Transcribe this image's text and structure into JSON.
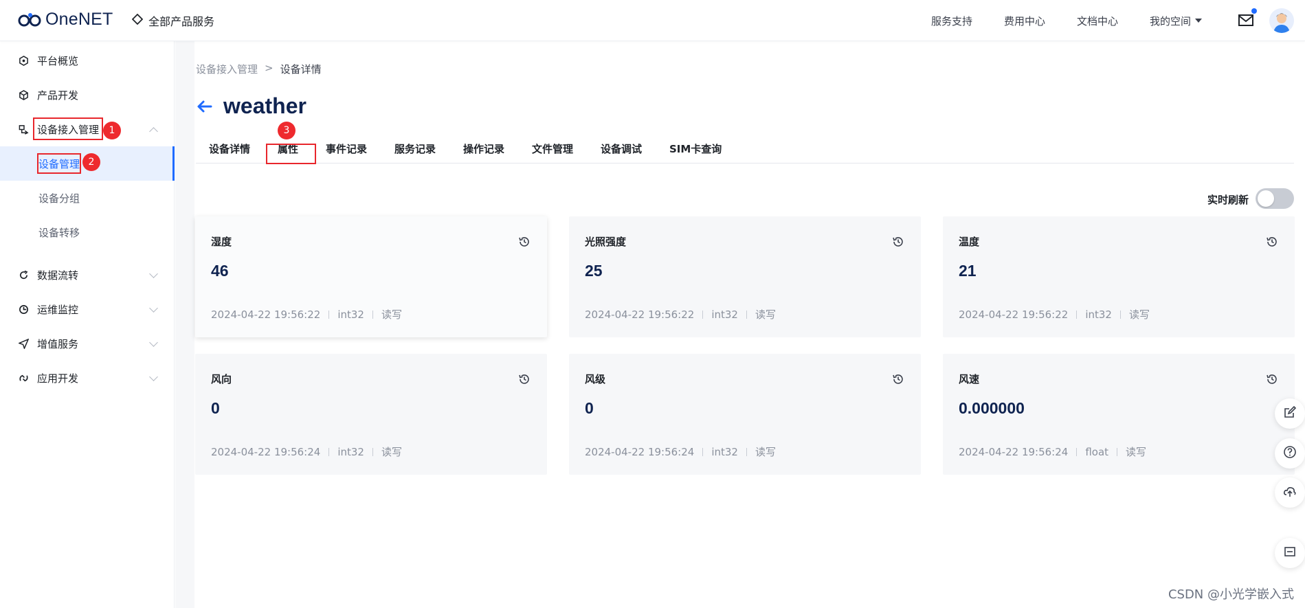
{
  "header": {
    "logo": "OneNET",
    "all_products": "全部产品服务",
    "nav": [
      "服务支持",
      "费用中心",
      "文档中心",
      "我的空间"
    ]
  },
  "sidebar": {
    "items": [
      {
        "label": "平台概览"
      },
      {
        "label": "产品开发"
      },
      {
        "label": "设备接入管理"
      },
      {
        "label": "设备管理"
      },
      {
        "label": "设备分组"
      },
      {
        "label": "设备转移"
      },
      {
        "label": "数据流转"
      },
      {
        "label": "运维监控"
      },
      {
        "label": "增值服务"
      },
      {
        "label": "应用开发"
      }
    ]
  },
  "annotations": [
    "1",
    "2",
    "3"
  ],
  "breadcrumb": {
    "parent": "设备接入管理",
    "separator": ">",
    "current": "设备详情"
  },
  "page": {
    "title": "weather"
  },
  "tabs": [
    "设备详情",
    "属性",
    "事件记录",
    "服务记录",
    "操作记录",
    "文件管理",
    "设备调试",
    "SIM卡查询"
  ],
  "toggle": {
    "label": "实时刷新",
    "on": false
  },
  "cards": [
    {
      "name": "湿度",
      "value": "46",
      "time": "2024-04-22 19:56:22",
      "type": "int32",
      "access": "读写"
    },
    {
      "name": "光照强度",
      "value": "25",
      "time": "2024-04-22 19:56:22",
      "type": "int32",
      "access": "读写"
    },
    {
      "name": "温度",
      "value": "21",
      "time": "2024-04-22 19:56:22",
      "type": "int32",
      "access": "读写"
    },
    {
      "name": "风向",
      "value": "0",
      "time": "2024-04-22 19:56:24",
      "type": "int32",
      "access": "读写"
    },
    {
      "name": "风级",
      "value": "0",
      "time": "2024-04-22 19:56:24",
      "type": "int32",
      "access": "读写"
    },
    {
      "name": "风速",
      "value": "0.000000",
      "time": "2024-04-22 19:56:24",
      "type": "float",
      "access": "读写"
    }
  ],
  "watermark": "CSDN @小光学嵌入式",
  "colors": {
    "accent": "#1f6bff",
    "annotation_red": "#e8262c",
    "title": "#0f2350"
  }
}
